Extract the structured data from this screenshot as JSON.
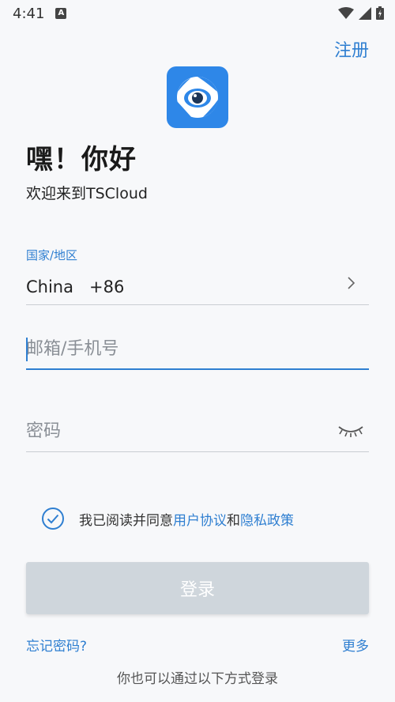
{
  "status_bar": {
    "time": "4:41",
    "notification_icon": "a-icon"
  },
  "header": {
    "register_label": "注册"
  },
  "logo": {
    "icon": "eye-lens-icon",
    "color": "#2e87e8"
  },
  "greeting": {
    "title": "嘿！你好",
    "subtitle": "欢迎来到TSCloud"
  },
  "form": {
    "country_label": "国家/地区",
    "country_name": "China",
    "country_code": "+86",
    "phone_placeholder": "邮箱/手机号",
    "password_placeholder": "密码"
  },
  "agreement": {
    "prefix": "我已阅读并同意",
    "user_agreement": "用户协议",
    "and": "和",
    "privacy_policy": "隐私政策",
    "checked": true
  },
  "login_button": {
    "label": "登录"
  },
  "footer": {
    "forgot_label": "忘记密码?",
    "more_label": "更多",
    "alt_login_text": "你也可以通过以下方式登录"
  },
  "colors": {
    "accent": "#2f7fd1",
    "button_disabled": "#cfd6dc"
  }
}
